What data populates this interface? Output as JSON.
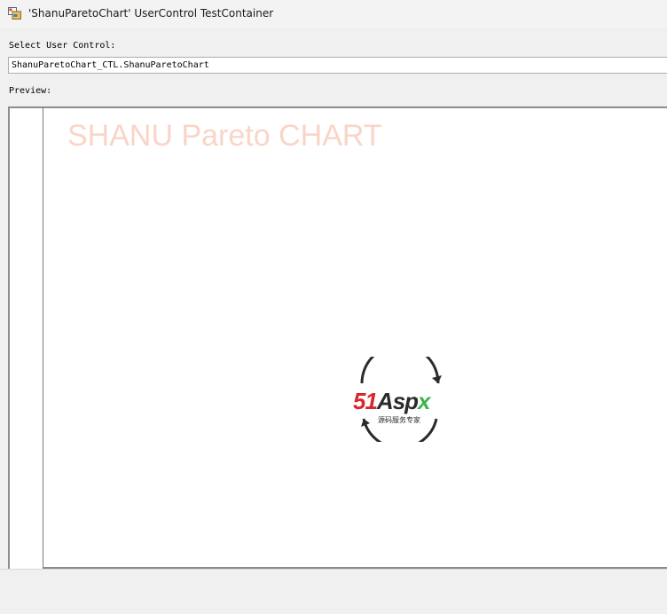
{
  "window": {
    "title": "'ShanuParetoChart' UserControl TestContainer"
  },
  "form": {
    "select_label": "Select User Control:",
    "selected_control": "ShanuParetoChart_CTL.ShanuParetoChart",
    "preview_label": "Preview:"
  },
  "preview": {
    "chart_title": "SHANU Pareto CHART",
    "logo": {
      "text_main": "51Aspx",
      "text_sub": "源码服务专家",
      "colors": {
        "red": "#d9262c",
        "dark": "#2b2b2b",
        "green": "#3bb54a"
      }
    }
  },
  "colors": {
    "window_bg": "#f0f0f0",
    "chart_title": "#f9d5c8",
    "preview_border": "#8c8c8c"
  }
}
